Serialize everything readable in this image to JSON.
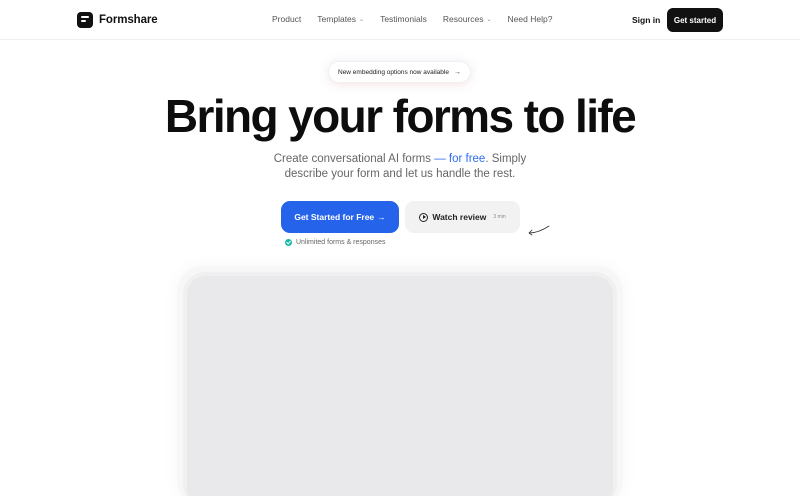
{
  "brand": {
    "name": "Formshare"
  },
  "nav": {
    "items": [
      {
        "label": "Product",
        "dropdown": false
      },
      {
        "label": "Templates",
        "dropdown": true
      },
      {
        "label": "Testimonials",
        "dropdown": false
      },
      {
        "label": "Resources",
        "dropdown": true
      },
      {
        "label": "Need Help?",
        "dropdown": false
      }
    ],
    "signin_label": "Sign in",
    "cta_label": "Get started"
  },
  "announcement": {
    "label": "New embedding options now available",
    "arrow": "→"
  },
  "hero": {
    "title": "Bring your forms to life",
    "subtitle_part1": "Create conversational AI forms ",
    "subtitle_highlight": "— for free",
    "subtitle_part2": ". Simply",
    "subtitle_line2": "describe your form and let us handle the rest."
  },
  "cta": {
    "primary_label": "Get Started for Free",
    "primary_arrow": "→",
    "secondary_label": "Watch review",
    "secondary_duration": "3 min",
    "note": "Unlimited forms & responses"
  },
  "colors": {
    "accent": "#2563eb",
    "dark": "#111111",
    "check": "#14b8a6"
  }
}
